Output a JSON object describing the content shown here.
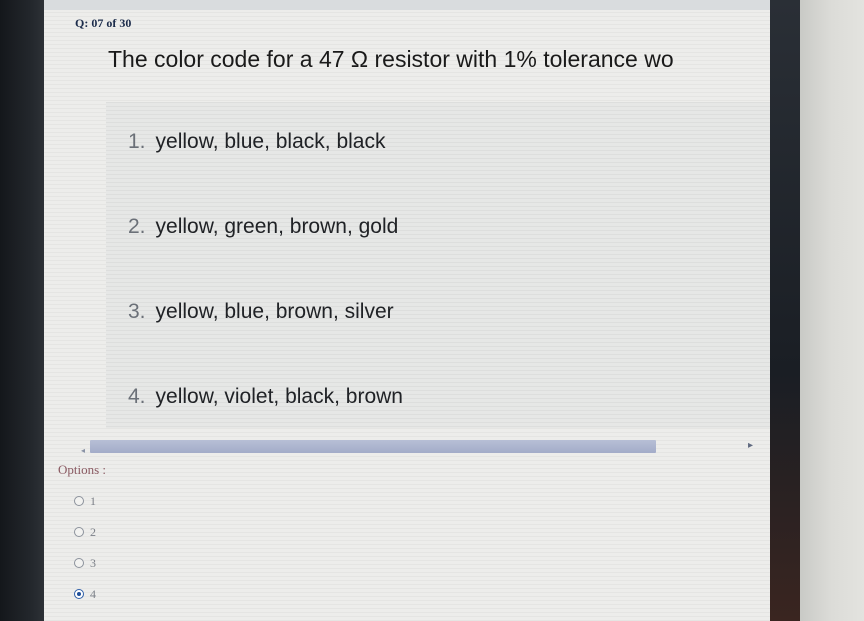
{
  "header": {
    "counter": "Q: 07 of 30"
  },
  "question": {
    "text": "The color code for a 47 Ω resistor with 1% tolerance wo"
  },
  "answers": [
    {
      "num": "1.",
      "text": "yellow, blue, black, black"
    },
    {
      "num": "2.",
      "text": "yellow, green, brown, gold"
    },
    {
      "num": "3.",
      "text": "yellow, blue, brown, silver"
    },
    {
      "num": "4.",
      "text": "yellow, violet, black, brown"
    }
  ],
  "options": {
    "label": "Options :",
    "items": [
      {
        "value": "1",
        "checked": false
      },
      {
        "value": "2",
        "checked": false
      },
      {
        "value": "3",
        "checked": false
      },
      {
        "value": "4",
        "checked": true
      }
    ]
  },
  "scrollbar": {
    "left_arrow": "◂",
    "right_arrow": "▸"
  },
  "colors": {
    "selected_radio": "#1f4f9a",
    "scrollbar": "#a9b1cc"
  }
}
